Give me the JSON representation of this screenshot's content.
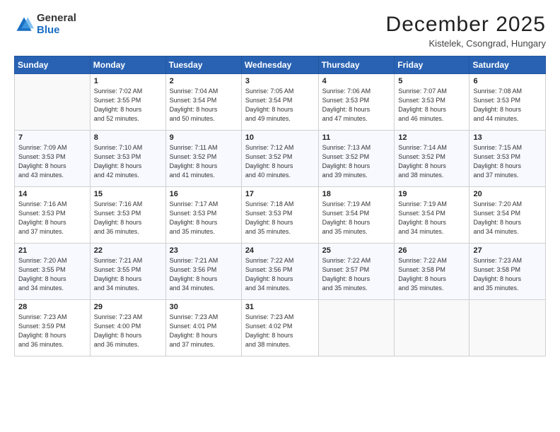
{
  "header": {
    "logo_general": "General",
    "logo_blue": "Blue",
    "title": "December 2025",
    "location": "Kistelek, Csongrad, Hungary"
  },
  "calendar": {
    "days_of_week": [
      "Sunday",
      "Monday",
      "Tuesday",
      "Wednesday",
      "Thursday",
      "Friday",
      "Saturday"
    ],
    "weeks": [
      [
        {
          "day": "",
          "info": ""
        },
        {
          "day": "1",
          "info": "Sunrise: 7:02 AM\nSunset: 3:55 PM\nDaylight: 8 hours\nand 52 minutes."
        },
        {
          "day": "2",
          "info": "Sunrise: 7:04 AM\nSunset: 3:54 PM\nDaylight: 8 hours\nand 50 minutes."
        },
        {
          "day": "3",
          "info": "Sunrise: 7:05 AM\nSunset: 3:54 PM\nDaylight: 8 hours\nand 49 minutes."
        },
        {
          "day": "4",
          "info": "Sunrise: 7:06 AM\nSunset: 3:53 PM\nDaylight: 8 hours\nand 47 minutes."
        },
        {
          "day": "5",
          "info": "Sunrise: 7:07 AM\nSunset: 3:53 PM\nDaylight: 8 hours\nand 46 minutes."
        },
        {
          "day": "6",
          "info": "Sunrise: 7:08 AM\nSunset: 3:53 PM\nDaylight: 8 hours\nand 44 minutes."
        }
      ],
      [
        {
          "day": "7",
          "info": "Sunrise: 7:09 AM\nSunset: 3:53 PM\nDaylight: 8 hours\nand 43 minutes."
        },
        {
          "day": "8",
          "info": "Sunrise: 7:10 AM\nSunset: 3:53 PM\nDaylight: 8 hours\nand 42 minutes."
        },
        {
          "day": "9",
          "info": "Sunrise: 7:11 AM\nSunset: 3:52 PM\nDaylight: 8 hours\nand 41 minutes."
        },
        {
          "day": "10",
          "info": "Sunrise: 7:12 AM\nSunset: 3:52 PM\nDaylight: 8 hours\nand 40 minutes."
        },
        {
          "day": "11",
          "info": "Sunrise: 7:13 AM\nSunset: 3:52 PM\nDaylight: 8 hours\nand 39 minutes."
        },
        {
          "day": "12",
          "info": "Sunrise: 7:14 AM\nSunset: 3:52 PM\nDaylight: 8 hours\nand 38 minutes."
        },
        {
          "day": "13",
          "info": "Sunrise: 7:15 AM\nSunset: 3:53 PM\nDaylight: 8 hours\nand 37 minutes."
        }
      ],
      [
        {
          "day": "14",
          "info": "Sunrise: 7:16 AM\nSunset: 3:53 PM\nDaylight: 8 hours\nand 37 minutes."
        },
        {
          "day": "15",
          "info": "Sunrise: 7:16 AM\nSunset: 3:53 PM\nDaylight: 8 hours\nand 36 minutes."
        },
        {
          "day": "16",
          "info": "Sunrise: 7:17 AM\nSunset: 3:53 PM\nDaylight: 8 hours\nand 35 minutes."
        },
        {
          "day": "17",
          "info": "Sunrise: 7:18 AM\nSunset: 3:53 PM\nDaylight: 8 hours\nand 35 minutes."
        },
        {
          "day": "18",
          "info": "Sunrise: 7:19 AM\nSunset: 3:54 PM\nDaylight: 8 hours\nand 35 minutes."
        },
        {
          "day": "19",
          "info": "Sunrise: 7:19 AM\nSunset: 3:54 PM\nDaylight: 8 hours\nand 34 minutes."
        },
        {
          "day": "20",
          "info": "Sunrise: 7:20 AM\nSunset: 3:54 PM\nDaylight: 8 hours\nand 34 minutes."
        }
      ],
      [
        {
          "day": "21",
          "info": "Sunrise: 7:20 AM\nSunset: 3:55 PM\nDaylight: 8 hours\nand 34 minutes."
        },
        {
          "day": "22",
          "info": "Sunrise: 7:21 AM\nSunset: 3:55 PM\nDaylight: 8 hours\nand 34 minutes."
        },
        {
          "day": "23",
          "info": "Sunrise: 7:21 AM\nSunset: 3:56 PM\nDaylight: 8 hours\nand 34 minutes."
        },
        {
          "day": "24",
          "info": "Sunrise: 7:22 AM\nSunset: 3:56 PM\nDaylight: 8 hours\nand 34 minutes."
        },
        {
          "day": "25",
          "info": "Sunrise: 7:22 AM\nSunset: 3:57 PM\nDaylight: 8 hours\nand 35 minutes."
        },
        {
          "day": "26",
          "info": "Sunrise: 7:22 AM\nSunset: 3:58 PM\nDaylight: 8 hours\nand 35 minutes."
        },
        {
          "day": "27",
          "info": "Sunrise: 7:23 AM\nSunset: 3:58 PM\nDaylight: 8 hours\nand 35 minutes."
        }
      ],
      [
        {
          "day": "28",
          "info": "Sunrise: 7:23 AM\nSunset: 3:59 PM\nDaylight: 8 hours\nand 36 minutes."
        },
        {
          "day": "29",
          "info": "Sunrise: 7:23 AM\nSunset: 4:00 PM\nDaylight: 8 hours\nand 36 minutes."
        },
        {
          "day": "30",
          "info": "Sunrise: 7:23 AM\nSunset: 4:01 PM\nDaylight: 8 hours\nand 37 minutes."
        },
        {
          "day": "31",
          "info": "Sunrise: 7:23 AM\nSunset: 4:02 PM\nDaylight: 8 hours\nand 38 minutes."
        },
        {
          "day": "",
          "info": ""
        },
        {
          "day": "",
          "info": ""
        },
        {
          "day": "",
          "info": ""
        }
      ]
    ]
  }
}
